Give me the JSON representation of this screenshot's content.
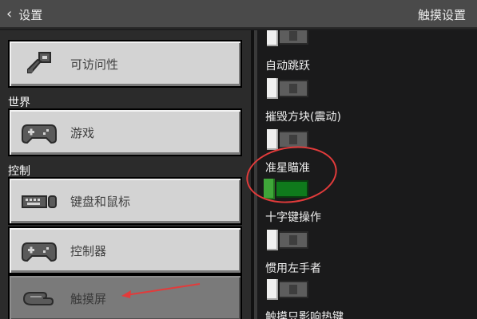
{
  "header": {
    "back_label": "设置",
    "title": "触摸设置"
  },
  "sidebar": {
    "items": [
      {
        "label": "可访问性",
        "icon": "key-icon"
      },
      {
        "label": "游戏",
        "icon": "gamepad-icon"
      },
      {
        "label": "键盘和鼠标",
        "icon": "keyboard-mouse-icon"
      },
      {
        "label": "控制器",
        "icon": "gamepad-icon"
      },
      {
        "label": "触摸屏",
        "icon": "touch-hand-icon",
        "selected": true
      }
    ],
    "sections": {
      "world": "世界",
      "controls": "控制"
    }
  },
  "options": [
    {
      "label": "",
      "value": false
    },
    {
      "label": "自动跳跃",
      "value": false
    },
    {
      "label": "摧毁方块(震动)",
      "value": false
    },
    {
      "label": "准星瞄准",
      "value": true
    },
    {
      "label": "十字键操作",
      "value": false
    },
    {
      "label": "惯用左手者",
      "value": false
    },
    {
      "label": "触摸只影响热键",
      "value": null
    }
  ],
  "annotations": {
    "highlight_color": "#e23b3b"
  },
  "colors": {
    "toggle_on": "#0f7a1c",
    "toggle_off": "#5d5d5d",
    "annotation_red": "#e23b3b"
  }
}
